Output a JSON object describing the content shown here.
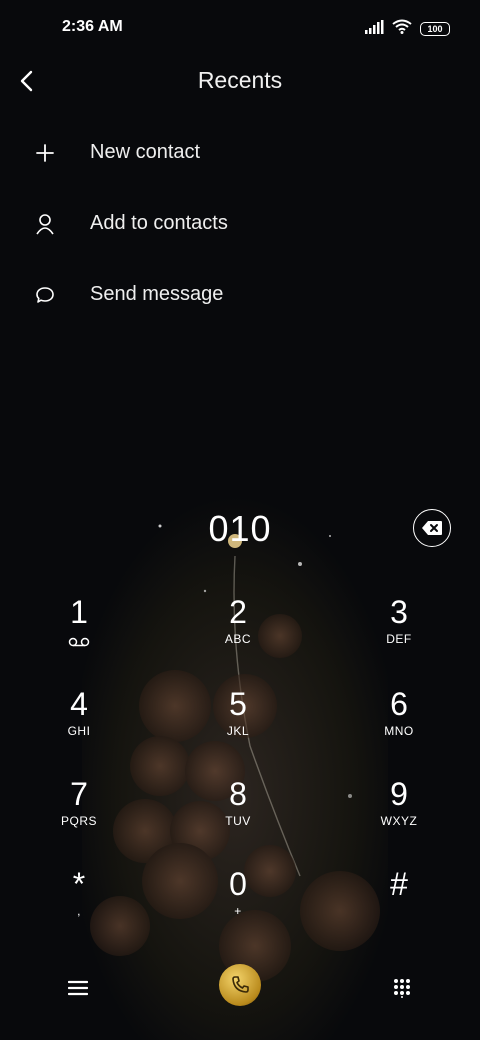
{
  "status_bar": {
    "time": "2:36 AM",
    "battery": "100"
  },
  "header": {
    "title": "Recents",
    "back_icon": "back-arrow-icon"
  },
  "menu": {
    "items": [
      {
        "label": "New contact",
        "icon": "plus-icon"
      },
      {
        "label": "Add to contacts",
        "icon": "person-icon"
      },
      {
        "label": "Send message",
        "icon": "chat-bubble-icon"
      }
    ]
  },
  "dialer": {
    "number": "010",
    "keys": [
      {
        "digit": "1",
        "letters": ""
      },
      {
        "digit": "2",
        "letters": "ABC"
      },
      {
        "digit": "3",
        "letters": "DEF"
      },
      {
        "digit": "4",
        "letters": "GHI"
      },
      {
        "digit": "5",
        "letters": "JKL"
      },
      {
        "digit": "6",
        "letters": "MNO"
      },
      {
        "digit": "7",
        "letters": "PQRS"
      },
      {
        "digit": "8",
        "letters": "TUV"
      },
      {
        "digit": "9",
        "letters": "WXYZ"
      },
      {
        "digit": "*",
        "letters": ","
      },
      {
        "digit": "0",
        "letters": "+"
      },
      {
        "digit": "#",
        "letters": ""
      }
    ]
  },
  "colors": {
    "background": "#08090c",
    "call_button": "#d4a72c",
    "text": "#ffffff"
  }
}
